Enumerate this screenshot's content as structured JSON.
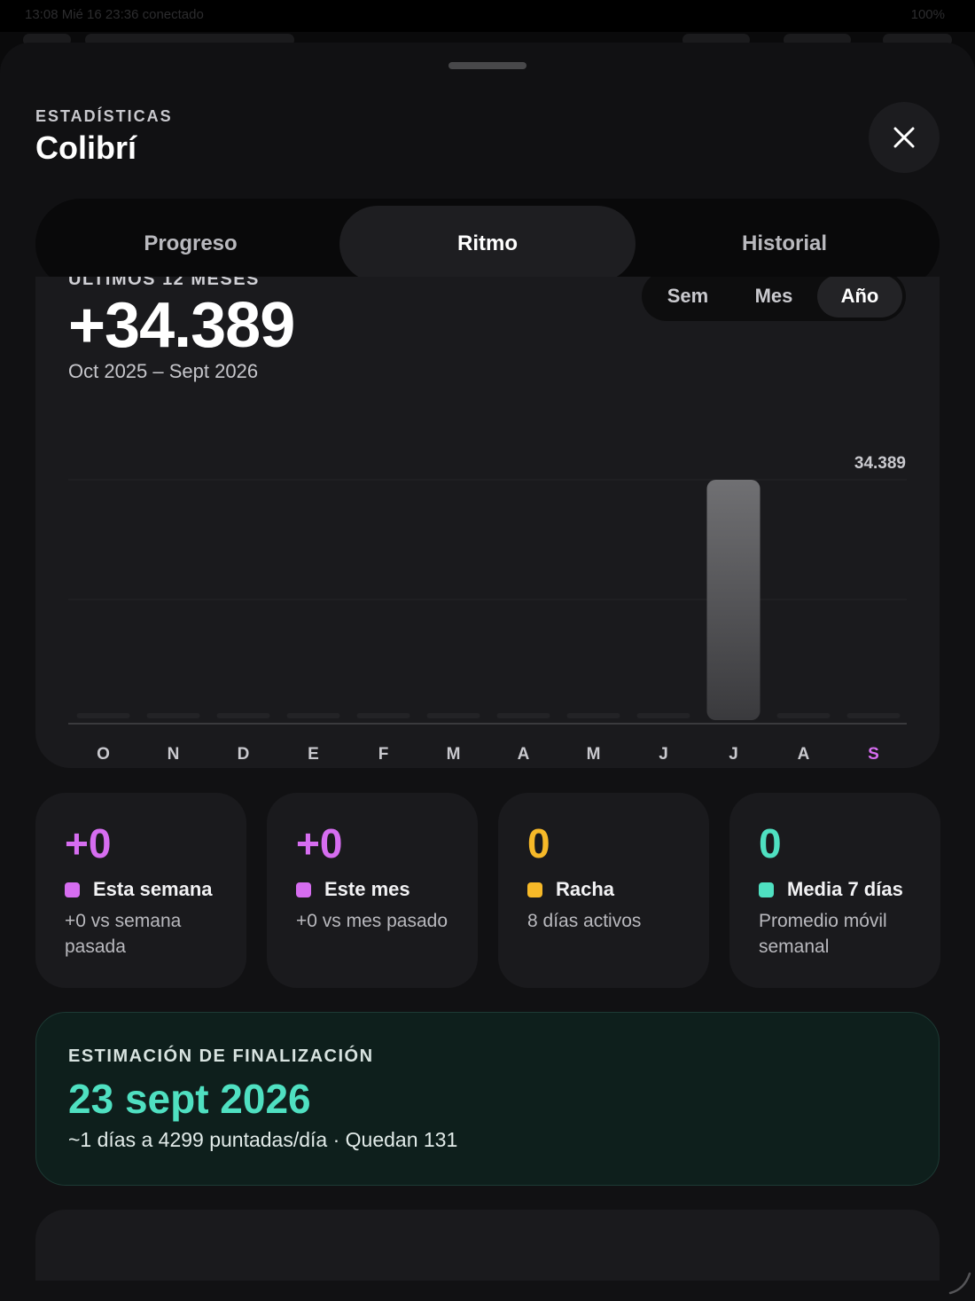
{
  "status_bar": {
    "left": "13:08  Mié 16 23:36 conectado",
    "right": "100%"
  },
  "header": {
    "eyebrow": "ESTADÍSTICAS",
    "title": "Colibrí"
  },
  "tabs": [
    {
      "label": "Progreso",
      "active": false
    },
    {
      "label": "Ritmo",
      "active": true
    },
    {
      "label": "Historial",
      "active": false
    }
  ],
  "pace_card": {
    "period_label": "ÚLTIMOS 12 MESES",
    "total": "+34.389",
    "range": "Oct 2025 – Sept 2026",
    "range_tabs": [
      {
        "label": "Sem",
        "active": false
      },
      {
        "label": "Mes",
        "active": false
      },
      {
        "label": "Año",
        "active": true
      }
    ]
  },
  "chart_data": {
    "type": "bar",
    "categories": [
      "O",
      "N",
      "D",
      "E",
      "F",
      "M",
      "A",
      "M",
      "J",
      "J",
      "A",
      "S"
    ],
    "values": [
      0,
      0,
      0,
      0,
      0,
      0,
      0,
      0,
      0,
      34389,
      0,
      0
    ],
    "ymax_label": "34.389",
    "ylim": [
      0,
      34389
    ],
    "grid": true,
    "current_index": 11,
    "highlight_color": "#d66df0"
  },
  "stats": [
    {
      "value": "+0",
      "label": "Esta semana",
      "sub": "+0 vs semana pasada",
      "color": "#d66df0"
    },
    {
      "value": "+0",
      "label": "Este mes",
      "sub": "+0 vs mes pasado",
      "color": "#d66df0"
    },
    {
      "value": "0",
      "label": "Racha",
      "sub": "8 días activos",
      "color": "#f7b928"
    },
    {
      "value": "0",
      "label": "Media 7 días",
      "sub": "Promedio móvil semanal",
      "color": "#4fe0c1"
    }
  ],
  "estimate": {
    "heading": "ESTIMACIÓN DE FINALIZACIÓN",
    "date": "23 sept 2026",
    "detail": "~1 días a 4299 puntadas/día · Quedan 131"
  }
}
